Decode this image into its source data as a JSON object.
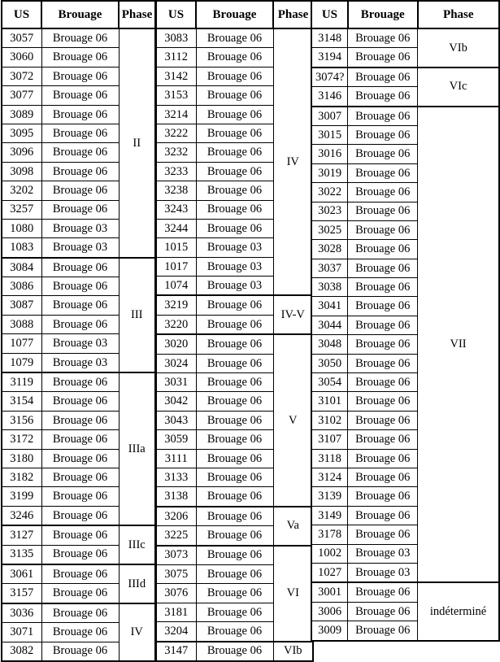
{
  "table": {
    "headers": {
      "us": "US",
      "brouage": "Brouage",
      "phase": "Phase"
    },
    "blocks": [
      {
        "id": "block-1",
        "rows": [
          {
            "us": "3057",
            "brouage": "Brouage 06"
          },
          {
            "us": "3060",
            "brouage": "Brouage 06"
          },
          {
            "us": "3072",
            "brouage": "Brouage 06"
          },
          {
            "us": "3077",
            "brouage": "Brouage 06"
          },
          {
            "us": "3089",
            "brouage": "Brouage 06"
          },
          {
            "us": "3095",
            "brouage": "Brouage 06"
          },
          {
            "us": "3096",
            "brouage": "Brouage 06"
          },
          {
            "us": "3098",
            "brouage": "Brouage 06"
          },
          {
            "us": "3202",
            "brouage": "Brouage 06"
          },
          {
            "us": "3257",
            "brouage": "Brouage 06"
          },
          {
            "us": "1080",
            "brouage": "Brouage 03"
          },
          {
            "us": "1083",
            "brouage": "Brouage 03"
          },
          {
            "us": "3084",
            "brouage": "Brouage 06"
          },
          {
            "us": "3086",
            "brouage": "Brouage 06"
          },
          {
            "us": "3087",
            "brouage": "Brouage 06"
          },
          {
            "us": "3088",
            "brouage": "Brouage 06"
          },
          {
            "us": "1077",
            "brouage": "Brouage 03"
          },
          {
            "us": "1079",
            "brouage": "Brouage 03"
          },
          {
            "us": "3119",
            "brouage": "Brouage 06"
          },
          {
            "us": "3154",
            "brouage": "Brouage 06"
          },
          {
            "us": "3156",
            "brouage": "Brouage 06"
          },
          {
            "us": "3172",
            "brouage": "Brouage 06"
          },
          {
            "us": "3180",
            "brouage": "Brouage 06"
          },
          {
            "us": "3182",
            "brouage": "Brouage 06"
          },
          {
            "us": "3199",
            "brouage": "Brouage 06"
          },
          {
            "us": "3246",
            "brouage": "Brouage 06"
          },
          {
            "us": "3127",
            "brouage": "Brouage 06"
          },
          {
            "us": "3135",
            "brouage": "Brouage 06"
          },
          {
            "us": "3061",
            "brouage": "Brouage 06"
          },
          {
            "us": "3157",
            "brouage": "Brouage 06"
          },
          {
            "us": "3036",
            "brouage": "Brouage 06"
          },
          {
            "us": "3071",
            "brouage": "Brouage 06"
          },
          {
            "us": "3082",
            "brouage": "Brouage 06"
          }
        ],
        "phases": [
          {
            "label": "II",
            "start": 0,
            "span": 12
          },
          {
            "label": "III",
            "start": 12,
            "span": 6
          },
          {
            "label": "IIIa",
            "start": 18,
            "span": 8
          },
          {
            "label": "IIIc",
            "start": 26,
            "span": 2
          },
          {
            "label": "IIId",
            "start": 28,
            "span": 2
          },
          {
            "label": "IV",
            "start": 30,
            "span": 3
          }
        ]
      },
      {
        "id": "block-2",
        "rows": [
          {
            "us": "3083",
            "brouage": "Brouage 06"
          },
          {
            "us": "3112",
            "brouage": "Brouage 06"
          },
          {
            "us": "3142",
            "brouage": "Brouage 06"
          },
          {
            "us": "3153",
            "brouage": "Brouage 06"
          },
          {
            "us": "3214",
            "brouage": "Brouage 06"
          },
          {
            "us": "3222",
            "brouage": "Brouage 06"
          },
          {
            "us": "3232",
            "brouage": "Brouage 06"
          },
          {
            "us": "3233",
            "brouage": "Brouage 06"
          },
          {
            "us": "3238",
            "brouage": "Brouage 06"
          },
          {
            "us": "3243",
            "brouage": "Brouage 06"
          },
          {
            "us": "3244",
            "brouage": "Brouage 06"
          },
          {
            "us": "1015",
            "brouage": "Brouage 03"
          },
          {
            "us": "1017",
            "brouage": "Brouage 03"
          },
          {
            "us": "1074",
            "brouage": "Brouage 03"
          },
          {
            "us": "3219",
            "brouage": "Brouage 06"
          },
          {
            "us": "3220",
            "brouage": "Brouage 06"
          },
          {
            "us": "3020",
            "brouage": "Brouage 06"
          },
          {
            "us": "3024",
            "brouage": "Brouage 06"
          },
          {
            "us": "3031",
            "brouage": "Brouage 06"
          },
          {
            "us": "3042",
            "brouage": "Brouage 06"
          },
          {
            "us": "3043",
            "brouage": "Brouage 06"
          },
          {
            "us": "3059",
            "brouage": "Brouage 06"
          },
          {
            "us": "3111",
            "brouage": "Brouage 06"
          },
          {
            "us": "3133",
            "brouage": "Brouage 06"
          },
          {
            "us": "3138",
            "brouage": "Brouage 06"
          },
          {
            "us": "3206",
            "brouage": "Brouage 06"
          },
          {
            "us": "3225",
            "brouage": "Brouage 06"
          },
          {
            "us": "3073",
            "brouage": "Brouage 06"
          },
          {
            "us": "3075",
            "brouage": "Brouage 06"
          },
          {
            "us": "3076",
            "brouage": "Brouage 06"
          },
          {
            "us": "3181",
            "brouage": "Brouage 06"
          },
          {
            "us": "3204",
            "brouage": "Brouage 06"
          },
          {
            "us": "3147",
            "brouage": "Brouage 06"
          }
        ],
        "phases": [
          {
            "label": "IV",
            "start": 0,
            "span": 14
          },
          {
            "label": "IV-V",
            "start": 14,
            "span": 2
          },
          {
            "label": "V",
            "start": 16,
            "span": 9
          },
          {
            "label": "Va",
            "start": 25,
            "span": 2
          },
          {
            "label": "VI",
            "start": 27,
            "span": 5
          },
          {
            "label": "VIb",
            "start": 32,
            "span": 1
          }
        ]
      },
      {
        "id": "block-3",
        "rows": [
          {
            "us": "3148",
            "brouage": "Brouage 06"
          },
          {
            "us": "3194",
            "brouage": "Brouage 06"
          },
          {
            "us": "3074?",
            "brouage": "Brouage 06"
          },
          {
            "us": "3146",
            "brouage": "Brouage 06"
          },
          {
            "us": "3007",
            "brouage": "Brouage 06"
          },
          {
            "us": "3015",
            "brouage": "Brouage 06"
          },
          {
            "us": "3016",
            "brouage": "Brouage 06"
          },
          {
            "us": "3019",
            "brouage": "Brouage 06"
          },
          {
            "us": "3022",
            "brouage": "Brouage 06"
          },
          {
            "us": "3023",
            "brouage": "Brouage 06"
          },
          {
            "us": "3025",
            "brouage": "Brouage 06"
          },
          {
            "us": "3028",
            "brouage": "Brouage 06"
          },
          {
            "us": "3037",
            "brouage": "Brouage 06"
          },
          {
            "us": "3038",
            "brouage": "Brouage 06"
          },
          {
            "us": "3041",
            "brouage": "Brouage 06"
          },
          {
            "us": "3044",
            "brouage": "Brouage 06"
          },
          {
            "us": "3048",
            "brouage": "Brouage 06"
          },
          {
            "us": "3050",
            "brouage": "Brouage 06"
          },
          {
            "us": "3054",
            "brouage": "Brouage 06"
          },
          {
            "us": "3101",
            "brouage": "Brouage 06"
          },
          {
            "us": "3102",
            "brouage": "Brouage 06"
          },
          {
            "us": "3107",
            "brouage": "Brouage 06"
          },
          {
            "us": "3118",
            "brouage": "Brouage 06"
          },
          {
            "us": "3124",
            "brouage": "Brouage 06"
          },
          {
            "us": "3139",
            "brouage": "Brouage 06"
          },
          {
            "us": "3149",
            "brouage": "Brouage 06"
          },
          {
            "us": "3178",
            "brouage": "Brouage 06"
          },
          {
            "us": "1002",
            "brouage": "Brouage 03"
          },
          {
            "us": "1027",
            "brouage": "Brouage 03"
          },
          {
            "us": "3001",
            "brouage": "Brouage 06",
            "highlight": "#ff0000"
          },
          {
            "us": "3006",
            "brouage": "Brouage 06"
          },
          {
            "us": "3009",
            "brouage": "Brouage 06"
          }
        ],
        "phases": [
          {
            "label": "VIb",
            "start": 0,
            "span": 2
          },
          {
            "label": "VIc",
            "start": 2,
            "span": 2
          },
          {
            "label": "VII",
            "start": 4,
            "span": 25
          },
          {
            "label": "indéterminé",
            "start": 29,
            "span": 3
          }
        ]
      }
    ]
  },
  "colors": {
    "grid_line": "#000000",
    "text": "#000000",
    "highlight_red": "#ff0000",
    "background": "#ffffff"
  }
}
